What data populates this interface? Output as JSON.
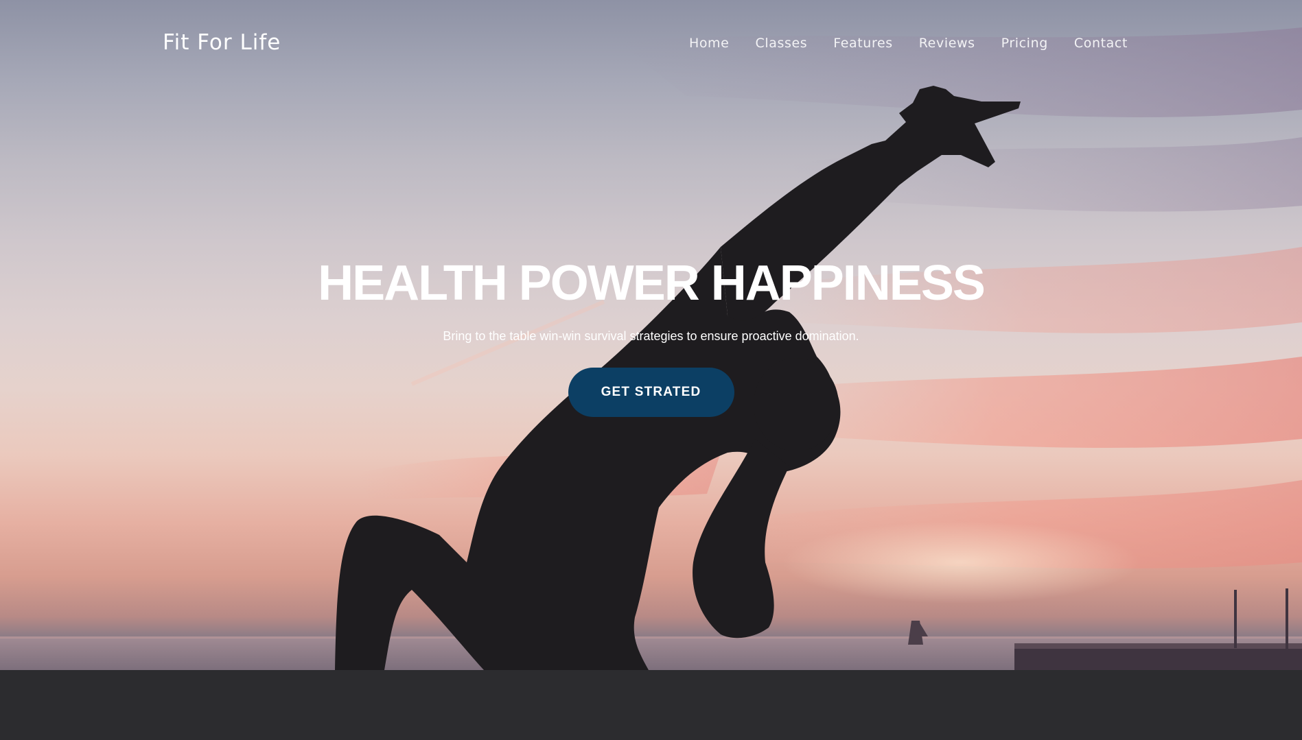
{
  "header": {
    "brand": "Fit For Life",
    "nav": [
      {
        "label": "Home"
      },
      {
        "label": "Classes"
      },
      {
        "label": "Features"
      },
      {
        "label": "Reviews"
      },
      {
        "label": "Pricing"
      },
      {
        "label": "Contact"
      }
    ]
  },
  "hero": {
    "title": "HEALTH POWER HAPPINESS",
    "subtitle": "Bring to the table win-win survival strategies to ensure proactive domination.",
    "cta_label": "GET STRATED",
    "background_image": "silhouette-yoga-pose-at-sunset"
  },
  "colors": {
    "cta_background": "#0c3f64",
    "footer_band": "#2c2c2f",
    "text": "#ffffff"
  }
}
